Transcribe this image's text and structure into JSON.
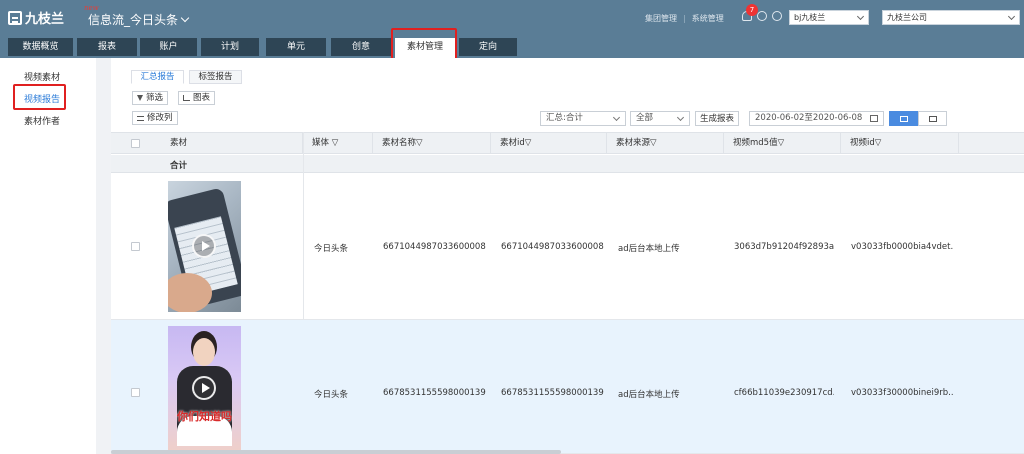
{
  "header": {
    "logo": "九枝兰",
    "app_title": "信息流_今日头条",
    "title_decor": "new",
    "links": [
      "集团管理",
      "系统管理"
    ],
    "notify_count": "7",
    "account_select": "bj九枝兰",
    "company_select": "九枝兰公司"
  },
  "nav": {
    "tabs": [
      {
        "label": "数据概览"
      },
      {
        "label": "报表"
      },
      {
        "label": "账户"
      },
      {
        "label": "计划"
      },
      {
        "label": "单元"
      },
      {
        "label": "创意"
      },
      {
        "label": "素材管理"
      },
      {
        "label": "定向"
      }
    ],
    "active_tab": "素材管理"
  },
  "sidebar": {
    "items": [
      {
        "label": "视频素材"
      },
      {
        "label": "视频报告"
      },
      {
        "label": "素材作者"
      }
    ],
    "active_item": "视频报告"
  },
  "main": {
    "subtabs": [
      {
        "label": "汇总报告"
      },
      {
        "label": "标签报告"
      }
    ],
    "filter_btn": "筛选",
    "chart_btn": "图表",
    "edit_cols_btn": "修改列",
    "summary_select": "汇总:合计",
    "scope_select": "全部",
    "generate_btn": "生成报表",
    "date_range": "2020-06-02至2020-06-08"
  },
  "table": {
    "columns": [
      "素材",
      "媒体",
      "素材名称",
      "素材id",
      "素材来源",
      "视频md5值",
      "视频id"
    ],
    "summary_label": "合计",
    "rows": [
      {
        "media": "今日头条",
        "name": "6671044987033600008",
        "id": "6671044987033600008",
        "source": "ad后台本地上传",
        "md5": "3063d7b91204f92893a...",
        "video_id": "v03033fb0000bia4vdet..."
      },
      {
        "media": "今日头条",
        "name": "6678531155598000139",
        "id": "6678531155598000139",
        "source": "ad后台本地上传",
        "md5": "cf66b11039e230917cd...",
        "video_id": "v03033f30000binei9rb...",
        "thumb_caption": "你们知道吗"
      }
    ]
  },
  "colors": {
    "header_bg": "#5a7d96",
    "tab_bg": "#2e4555",
    "accent": "#2b7bd8",
    "highlight": "#e02020"
  }
}
